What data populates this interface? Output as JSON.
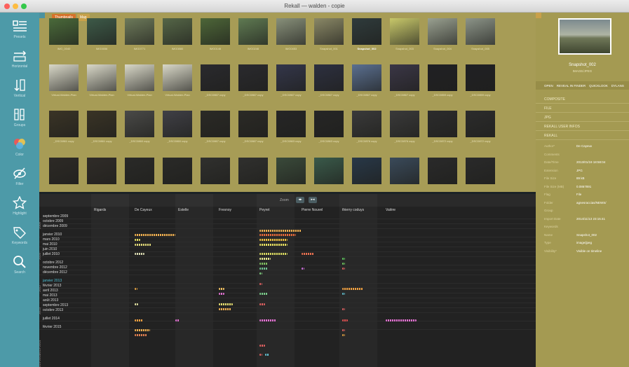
{
  "window": {
    "title": "Rekall — walden - copie",
    "traffic_colors": [
      "#fc605c",
      "#fdbc40",
      "#34c84a"
    ]
  },
  "sidebar": {
    "items": [
      {
        "label": "Presets",
        "icon": "list-icon"
      },
      {
        "label": "Horizontal",
        "icon": "horizontal-icon"
      },
      {
        "label": "Vertical",
        "icon": "vertical-icon"
      },
      {
        "label": "Groups",
        "icon": "groups-icon"
      },
      {
        "label": "Color",
        "icon": "color-icon"
      },
      {
        "label": "Filter",
        "icon": "filter-icon"
      },
      {
        "label": "Highlight",
        "icon": "star-icon"
      },
      {
        "label": "Keywords",
        "icon": "tag-icon"
      },
      {
        "label": "Search",
        "icon": "search-icon"
      }
    ]
  },
  "tabs": [
    "Thumbnails",
    "Map"
  ],
  "grid": {
    "rows": [
      {
        "captions": [
          "IMG_0040",
          "IMG0656",
          "IMG0771",
          "IMG0880",
          "IMG0146",
          "IMG0246",
          "IMG0453",
          "Snapshot_001",
          "Snapshot_002",
          "Snapshot_003",
          "Snapshot_004",
          "Snapshot_005"
        ]
      },
      {
        "captions": [
          "Virtual-Walden-Plan",
          "Virtual-Walden-Plan",
          "Virtual-Walden-Plan",
          "Virtual-Walden-Plan",
          "_DSC0867 copy",
          "_DSC0867 copy",
          "_DSC0867 copy",
          "_DSC0867 copy",
          "_DSC0867 copy",
          "_DSC0867 copy",
          "_DSC0859 copy",
          "_DSC0859 copy"
        ]
      },
      {
        "captions": [
          "_DSC0861 copy",
          "_DSC0861 copy",
          "_DSC0860 copy",
          "_DSC0860 copy",
          "_DSC0867 copy",
          "_DSC0867 copy",
          "_DSC0863 copy",
          "_DSC0863 copy",
          "_DSC0876 copy",
          "_DSC0876 copy",
          "_DSC0872 copy",
          "_DSC0872 copy"
        ]
      },
      {
        "captions": [
          "",
          "",
          "",
          "",
          "",
          "",
          "",
          "",
          "",
          "",
          "",
          ""
        ]
      }
    ],
    "selected_caption": "Snapshot_002"
  },
  "timeline": {
    "zoom_label": "Zoom",
    "people": [
      "Rigards",
      "De Cayeux",
      "Estelle",
      "Fresnoy",
      "Peyret",
      "Pierre Nouvel",
      "thierry coduys",
      "Valère"
    ],
    "months": [
      "septembre 2009",
      "octobre 2009",
      "décembre 2009",
      "",
      "janvier 2010",
      "mars 2010",
      "mai 2010",
      "juin 2010",
      "juillet 2010",
      "",
      "octobre 2012",
      "novembre 2012",
      "décembre 2012",
      "",
      "janvier 2013",
      "février 2013",
      "avril 2013",
      "mai 2013",
      "août 2013",
      "septembre 2013",
      "octobre 2013",
      "",
      "juillet 2014",
      "",
      "février 2015"
    ],
    "years": [
      "2009",
      "2010",
      "2012",
      "2013",
      "2013-2014",
      "2014-2015"
    ],
    "highlight_month": "janvier 2013",
    "highlight_color": "#4fc3d8"
  },
  "right_panel": {
    "name": "Snapshot_002",
    "format": "IMAGE/JPEG",
    "actions": [
      "OPEN",
      "REVEAL IN FINDER",
      "QUICKLOOK",
      "DYLANS"
    ],
    "sections": [
      "COMPOSITE",
      "FILE",
      "JPG",
      "REKALL USER INFOS",
      "REKALL"
    ],
    "meta": [
      {
        "k": "Author*",
        "v": "De Cayeux"
      },
      {
        "k": "Comments",
        "v": ""
      },
      {
        "k": "Date/Time",
        "v": "2013/01/19 18:58:04"
      },
      {
        "k": "Extension",
        "v": "JPG"
      },
      {
        "k": "File Size",
        "v": "89 kB"
      },
      {
        "k": "File Size (MB)",
        "v": "0.0867891"
      },
      {
        "k": "Flag",
        "v": "File"
      },
      {
        "k": "Folder",
        "v": "agnesraccias/NEWS/"
      },
      {
        "k": "Group",
        "v": ""
      },
      {
        "k": "Import Date",
        "v": "2014/11/13 23:15:41"
      },
      {
        "k": "Keywords",
        "v": ""
      },
      {
        "k": "Name",
        "v": "Snapshot_002"
      },
      {
        "k": "Type",
        "v": "image/jpeg"
      },
      {
        "k": "Visibility*",
        "v": "Visible on timeline"
      }
    ]
  }
}
